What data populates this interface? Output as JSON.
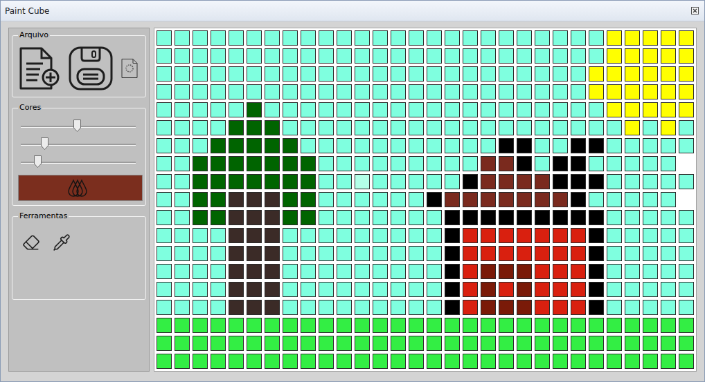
{
  "window": {
    "title": "Paint Cube"
  },
  "file_group": {
    "label": "Arquivo"
  },
  "colors_group": {
    "label": "Cores",
    "sliders": [
      {
        "name": "red",
        "level": 0.49
      },
      {
        "name": "green",
        "level": 0.19
      },
      {
        "name": "blue",
        "level": 0.12
      }
    ],
    "swatch": {
      "color": "#7b2e1e"
    }
  },
  "tools_group": {
    "label": "Ferramentas",
    "tools": [
      {
        "name": "eraser",
        "selected": false
      },
      {
        "name": "eyedropper",
        "selected": false
      }
    ]
  },
  "canvas": {
    "palette": {
      "c": "#7fffdf",
      "y": "#ffff00",
      "g": "#006400",
      "t": "#3b2b27",
      "k": "#000000",
      "b": "#7a2a1e",
      "r": "#d9200f",
      "d": "#7a1a08",
      "G": "#33ee44",
      "p": "#b3ffe8"
    },
    "rows": [
      "cccccccccccccccccccccccccyyyyy",
      "cccccccccccccccccccccccccyyyyy",
      "ccccccccccccccccccccccccyyyyyy",
      "ccccccccccccccccccccccccyyyyyy",
      "cccccgcccccccccccccccccccyyyyy",
      "ccccgggcccccccccccccccccccycyc",
      "cccgggggccccccccccckkcckkccccc",
      "ccgggggggcccccccccbbkckkccccc",
      "ccgggggggccpccccckbbbbkkkccccc",
      "ccggtttggcccccckbbbbbbbkccccc",
      "ccggtttggccccccckkkkkkkkkccccc",
      "cccctttccccccccckrrrrrrrkccccc",
      "cccctttccccccccckrrrrrrrkccccc",
      "cccctttccccccccckrdddrrrkccccc",
      "cccctttccccccccckrdrdrrrkccccc",
      "cccctttccccccccckrdddrrrkccccc",
      "GGGGGGGGGGGGGGGGGGGGGGGGGGGGGG",
      "GGGGGGGGGGGGGGGGGGGGGGGGGGGGGG",
      "GGGGGGGGGGGGGGGGGGGGGGGGGGGGGG"
    ]
  }
}
